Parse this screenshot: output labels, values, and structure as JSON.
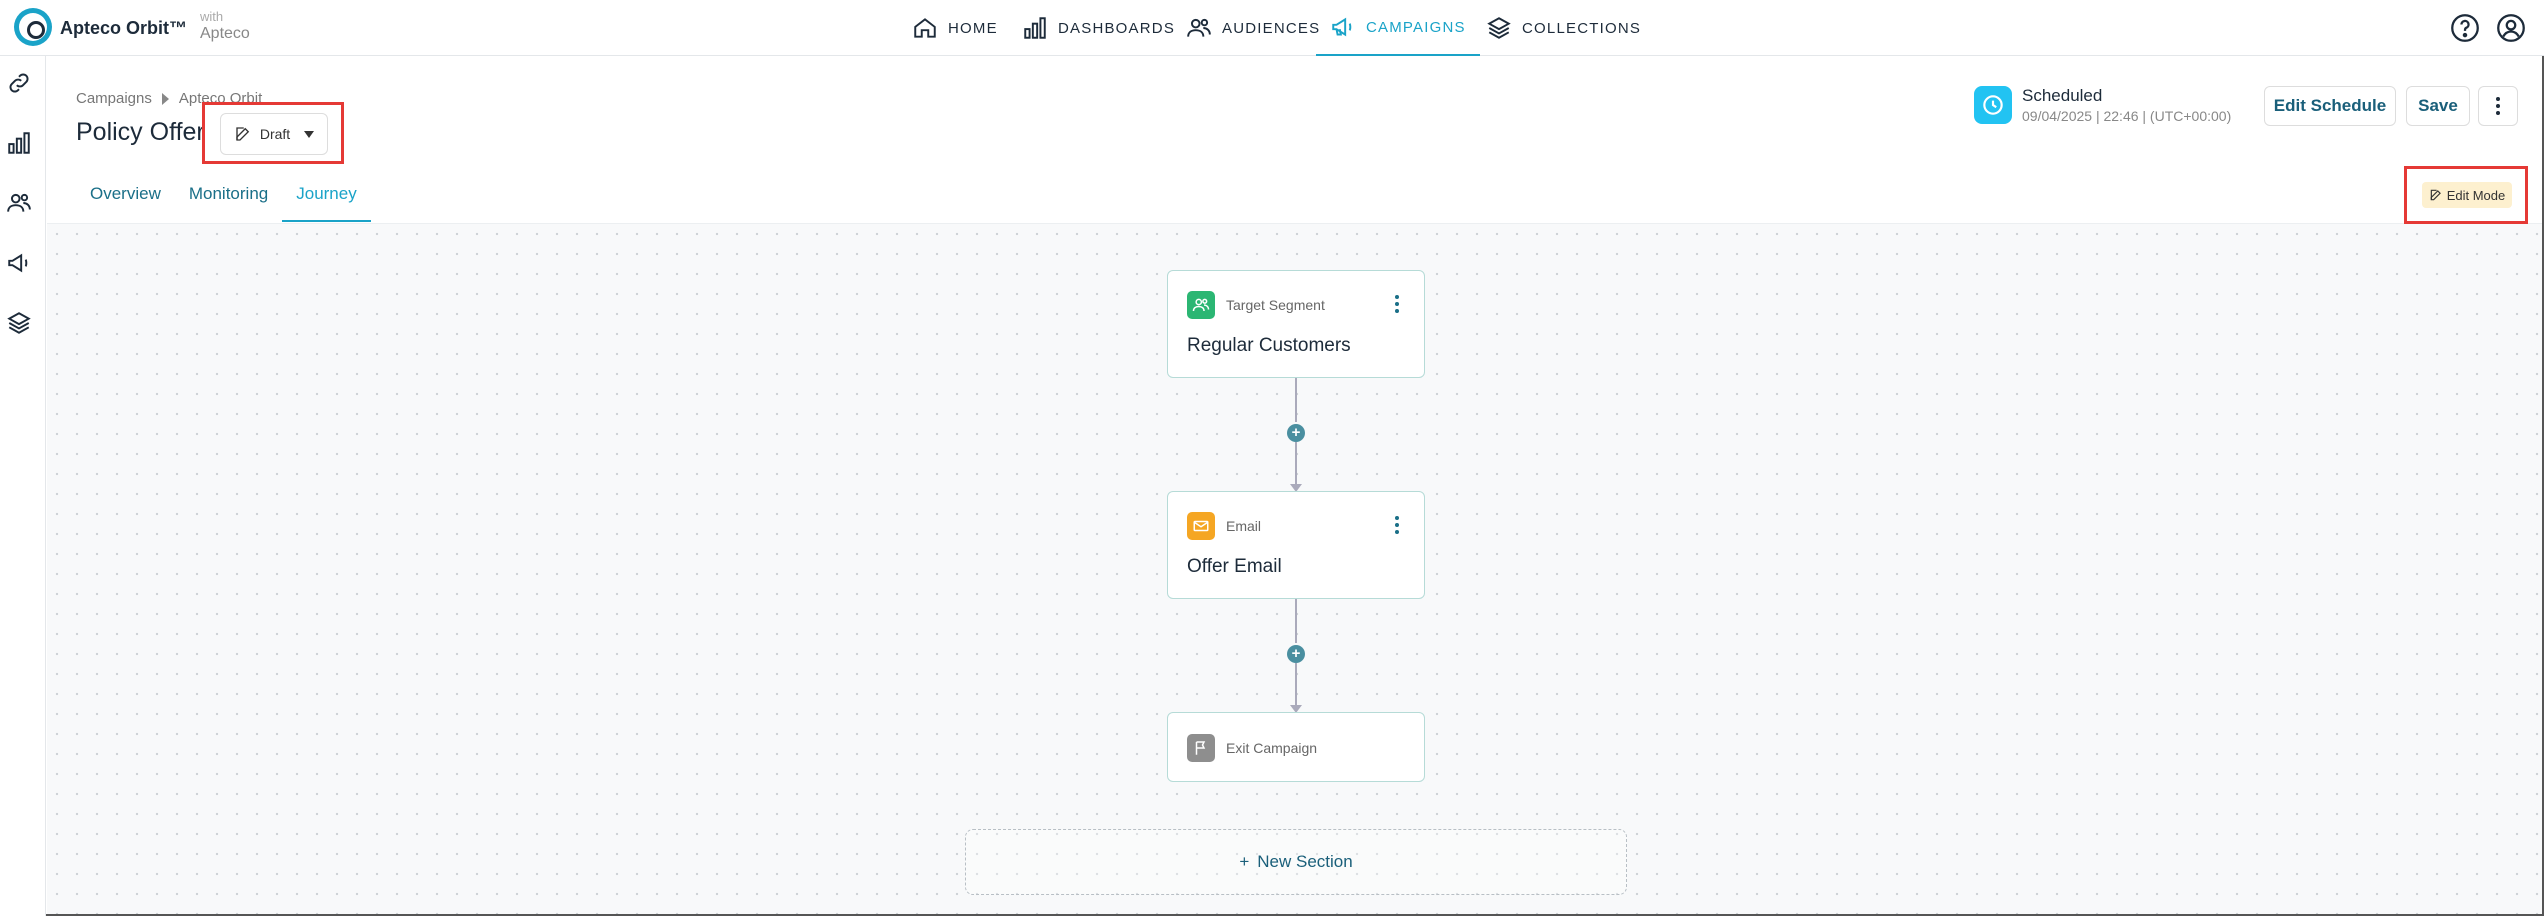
{
  "topbar": {
    "brand": "Apteco Orbit™",
    "with": "with",
    "with_brand": "Apteco",
    "nav": [
      {
        "label": "HOME",
        "icon": "home-icon"
      },
      {
        "label": "DASHBOARDS",
        "icon": "bar-chart-icon"
      },
      {
        "label": "AUDIENCES",
        "icon": "people-icon"
      },
      {
        "label": "CAMPAIGNS",
        "icon": "megaphone-icon",
        "active": true
      },
      {
        "label": "COLLECTIONS",
        "icon": "layers-icon"
      }
    ]
  },
  "rail": [
    "link-icon",
    "bar-chart-icon",
    "people-icon",
    "megaphone-icon",
    "layers-icon"
  ],
  "header": {
    "breadcrumb": [
      "Campaigns",
      "Apteco Orbit"
    ],
    "title": "Policy Offer",
    "status_label": "Draft",
    "tabs": [
      {
        "label": "Overview"
      },
      {
        "label": "Monitoring"
      },
      {
        "label": "Journey",
        "active": true
      }
    ],
    "schedule": {
      "title": "Scheduled",
      "date": "09/04/2025 | 22:46 | (UTC+00:00)"
    },
    "edit_schedule_label": "Edit Schedule",
    "save_label": "Save",
    "edit_mode_label": "Edit Mode"
  },
  "journey": {
    "nodes": [
      {
        "type": "Target Segment",
        "name": "Regular Customers",
        "color": "#2bb673"
      },
      {
        "type": "Email",
        "name": "Offer Email",
        "color": "#f5a623"
      },
      {
        "type": "Exit Campaign",
        "name": "",
        "color": "#8e8e8e"
      }
    ],
    "new_section_label": "New Section"
  },
  "colors": {
    "accent": "#1aa3c8",
    "highlight": "#e53935"
  }
}
